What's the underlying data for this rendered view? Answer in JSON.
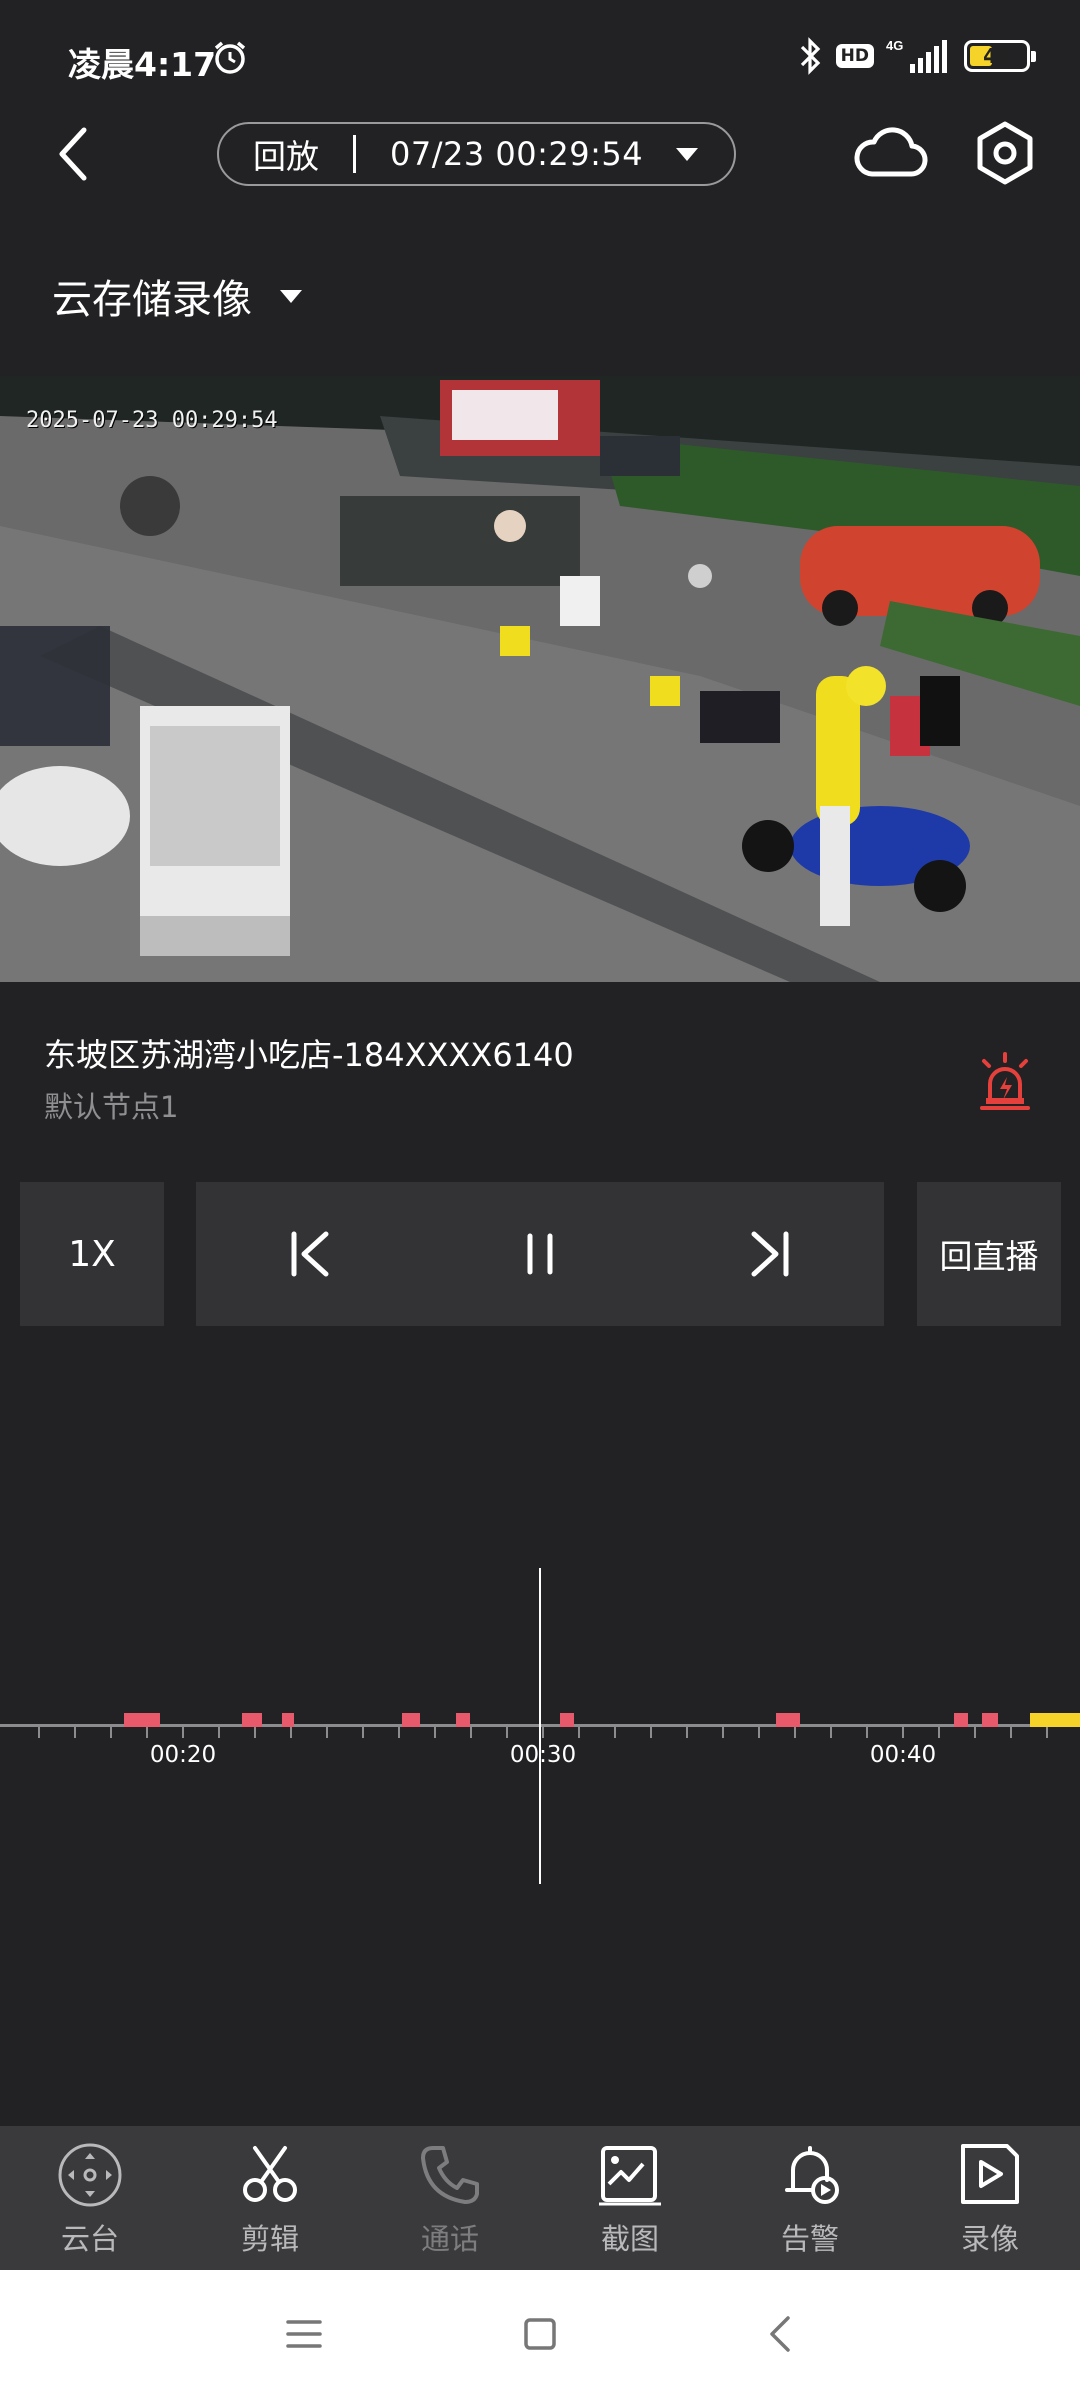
{
  "status_bar": {
    "time": "凌晨4:17",
    "hd_label": "HD",
    "network_label": "4G",
    "battery_level": 40,
    "battery_text": "40"
  },
  "header": {
    "mode_label": "回放",
    "datetime": "07/23 00:29:54",
    "back_icon": "chevron-left-icon",
    "cloud_icon": "cloud-icon",
    "settings_icon": "hexagon-gear-icon"
  },
  "storage": {
    "label": "云存储录像"
  },
  "video": {
    "osd_timestamp": "2025-07-23 00:29:54"
  },
  "device": {
    "name": "东坡区苏湖湾小吃店-184XXXX6140",
    "node": "默认节点1",
    "alarm_icon": "siren-icon",
    "alarm_color": "#e5403b"
  },
  "controls": {
    "speed_label": "1X",
    "prev_icon": "skip-previous-icon",
    "pause_icon": "pause-icon",
    "next_icon": "skip-next-icon",
    "live_label": "回直播"
  },
  "timeline": {
    "labels": [
      "00:20",
      "00:30",
      "00:40"
    ],
    "current_time": "00:29:54",
    "event_color": "#e85a6b",
    "highlight_color": "#f5d328"
  },
  "bottom_nav": {
    "items": [
      {
        "label": "云台",
        "icon": "ptz-icon",
        "enabled": true
      },
      {
        "label": "剪辑",
        "icon": "scissors-icon",
        "enabled": true
      },
      {
        "label": "通话",
        "icon": "phone-icon",
        "enabled": false
      },
      {
        "label": "截图",
        "icon": "screenshot-icon",
        "enabled": true
      },
      {
        "label": "告警",
        "icon": "alarm-bell-icon",
        "enabled": true
      },
      {
        "label": "录像",
        "icon": "video-record-icon",
        "enabled": true
      }
    ]
  },
  "system_nav": {
    "menu_icon": "menu-icon",
    "home_icon": "square-home-icon",
    "back_icon": "triangle-back-icon"
  }
}
